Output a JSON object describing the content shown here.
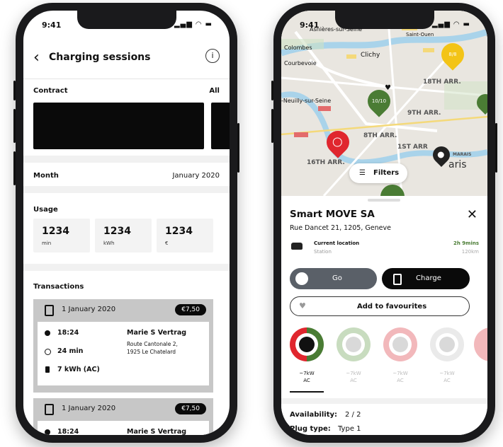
{
  "left": {
    "status_time": "9:41",
    "status_icons": "▂▄▆ ◠ ▬",
    "title": "Charging sessions",
    "back_icon": "‹",
    "info_icon": "i",
    "contract_label": "Contract",
    "contract_filter": "All",
    "month_label": "Month",
    "month_value": "January 2020",
    "usage_label": "Usage",
    "usage": [
      {
        "value": "1234",
        "unit": "min"
      },
      {
        "value": "1234",
        "unit": "kWh"
      },
      {
        "value": "1234",
        "unit": "€"
      }
    ],
    "transactions_label": "Transactions",
    "transactions": [
      {
        "date": "1 January 2020",
        "price": "€7,50",
        "time": "18:24",
        "duration": "24 min",
        "energy": "7 kWh (AC)",
        "contract": "Marie S Vertrag",
        "address_line1": "Route Cantonale 2,",
        "address_line2": "1925 Le Chatelard"
      },
      {
        "date": "1 January 2020",
        "price": "€7,50",
        "time": "18:24",
        "contract": "Marie S Vertrag"
      }
    ]
  },
  "right": {
    "status_time": "9:41",
    "status_icons": "▂▄▆ ◠ ▬",
    "map_labels": {
      "asnieres": "Asnières-sur-Seine",
      "saint_ouen": "Saint-Ouen",
      "colombes": "Colombes",
      "clichy": "Clichy",
      "courbevoie": "Courbevoie",
      "neuilly": "-Neuilly-sur-Seine",
      "arr18": "18TH ARR.",
      "arr9": "9TH ARR.",
      "arr8": "8TH ARR.",
      "arr1": "1ST ARR",
      "arr16": "16TH ARR.",
      "marais": "MARAIS",
      "paris": "aris"
    },
    "pins": {
      "yellow": "8/8",
      "green": "10/10"
    },
    "filters_label": "Filters",
    "station_name": "Smart MOVE SA",
    "station_address": "Rue Dancet 21, 1205, Geneve",
    "route_from": "Current location",
    "route_to": "Station",
    "route_time": "2h 9mins",
    "route_distance": "120km",
    "go_label": "Go",
    "charge_label": "Charge",
    "favourites_label": "Add to favourites",
    "connectors": [
      {
        "power": "~7kW",
        "type": "AC"
      },
      {
        "power": "~7kW",
        "type": "AC"
      },
      {
        "power": "~7kW",
        "type": "AC"
      },
      {
        "power": "~7kW",
        "type": "AC"
      }
    ],
    "availability_label": "Availability:",
    "availability_value": "2 / 2",
    "plug_type_label": "Plug type:",
    "plug_type_value": "Type 1",
    "colors": {
      "green": "#4a7c34",
      "red": "#e0262e",
      "yellow": "#f3c417",
      "dark": "#0a0a0a",
      "grey_button": "#5a6068"
    }
  }
}
